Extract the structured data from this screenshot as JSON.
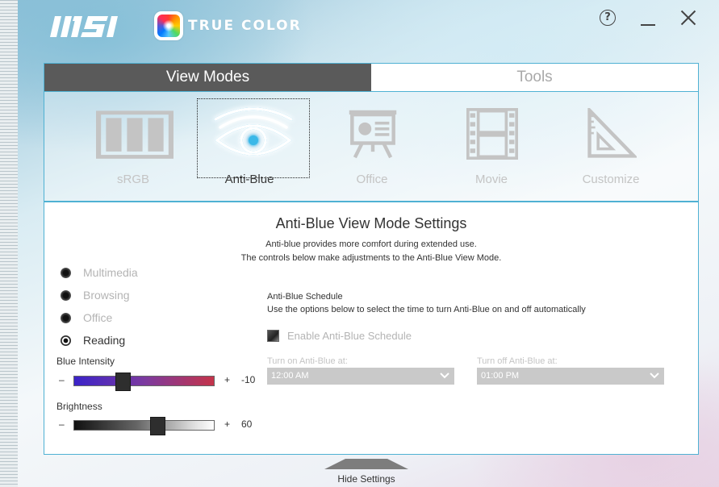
{
  "header": {
    "brand": "MSI",
    "app_title": "TRUE COLOR",
    "help_label": "?"
  },
  "tabs": [
    {
      "label": "View Modes",
      "active": true
    },
    {
      "label": "Tools",
      "active": false
    }
  ],
  "modes": [
    {
      "label": "sRGB",
      "icon": "srgb-icon",
      "selected": false
    },
    {
      "label": "Anti-Blue",
      "icon": "eye-icon",
      "selected": true
    },
    {
      "label": "Office",
      "icon": "presentation-icon",
      "selected": false
    },
    {
      "label": "Movie",
      "icon": "film-icon",
      "selected": false
    },
    {
      "label": "Customize",
      "icon": "ruler-triangle-icon",
      "selected": false
    }
  ],
  "settings": {
    "title": "Anti-Blue View Mode Settings",
    "desc1": "Anti-blue provides more comfort during extended use.",
    "desc2": "The controls below make adjustments to the Anti-Blue View Mode.",
    "presets": [
      {
        "label": "Multimedia",
        "checked": false
      },
      {
        "label": "Browsing",
        "checked": false
      },
      {
        "label": "Office",
        "checked": false
      },
      {
        "label": "Reading",
        "checked": true
      }
    ],
    "blue_intensity": {
      "label": "Blue Intensity",
      "minus": "–",
      "plus": "+",
      "value": "-10",
      "fraction": 0.35
    },
    "brightness": {
      "label": "Brightness",
      "minus": "–",
      "plus": "+",
      "value": "60",
      "fraction": 0.6
    },
    "schedule": {
      "title": "Anti-Blue Schedule",
      "desc": "Use the options below to select the time to turn Anti-Blue on and off automatically",
      "enable_label": "Enable Anti-Blue Schedule",
      "on_label": "Turn on Anti-Blue at:",
      "on_value": "12:00 AM",
      "off_label": "Turn off Anti-Blue at:",
      "off_value": "01:00 PM"
    }
  },
  "footer": {
    "hide_label": "Hide Settings"
  },
  "colors": {
    "accent": "#4fb1d3",
    "tab_active": "#5a5a5a",
    "icon_disabled": "#c4c4c4",
    "anti_blue_glow": "#3ab8e8"
  }
}
